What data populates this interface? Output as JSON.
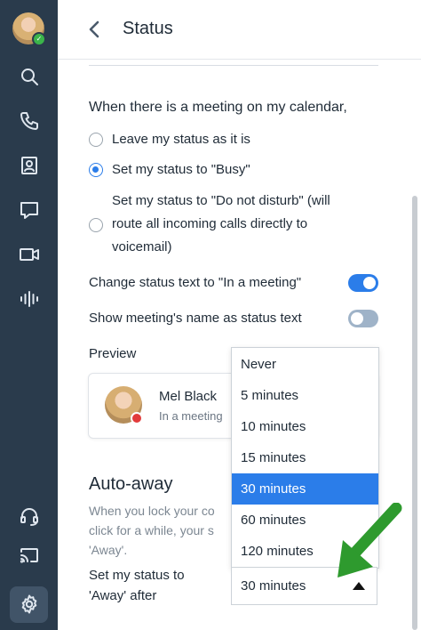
{
  "header": {
    "title": "Status"
  },
  "calendar": {
    "question": "When there is a meeting on my calendar,",
    "options": [
      {
        "lines": [
          "Leave my status as it is"
        ],
        "selected": false
      },
      {
        "lines": [
          "Set my status to \"Busy\""
        ],
        "selected": true
      },
      {
        "lines": [
          "Set my status to \"Do not disturb\" (will",
          "route all incoming calls directly to",
          "voicemail)"
        ],
        "selected": false
      }
    ]
  },
  "toggles": {
    "change_status_text": {
      "label": "Change status text to \"In a meeting\"",
      "on": true
    },
    "show_meeting_name": {
      "label": "Show meeting's name as status text",
      "on": false
    }
  },
  "preview": {
    "label": "Preview",
    "name": "Mel Black",
    "status": "In a meeting"
  },
  "auto_away": {
    "title": "Auto-away",
    "desc_line1": "When you lock your co",
    "desc_line2": "click for a while, your s",
    "desc_line3": "'Away'.",
    "set_label_line1": "Set my status to",
    "set_label_line2": "'Away' after",
    "selected_value": "30 minutes",
    "options": [
      "Never",
      "5 minutes",
      "10 minutes",
      "15 minutes",
      "30 minutes",
      "60 minutes",
      "120 minutes"
    ]
  },
  "colors": {
    "accent": "#2b7de9",
    "sidebar": "#2a3b4c",
    "annotation_arrow": "#2e9a2e"
  }
}
